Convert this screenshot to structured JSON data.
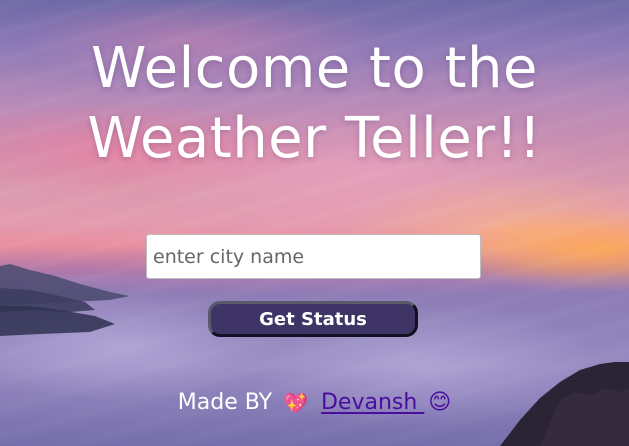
{
  "page": {
    "title_line1": "Welcome to the",
    "title_line2": "Weather Teller!!"
  },
  "search": {
    "placeholder": "enter city name",
    "value": ""
  },
  "actions": {
    "get_status_label": "Get Status"
  },
  "footer": {
    "made_by": "Made BY",
    "heart_emoji": "💖",
    "author_name": "Devansh",
    "smile_emoji": "😊"
  },
  "icons": {
    "heart": "sparkling-heart-icon",
    "smile": "smiling-face-icon"
  },
  "colors": {
    "title_text": "#ffffff",
    "button_bg": "#3f3466",
    "link": "#4a0d9c"
  }
}
